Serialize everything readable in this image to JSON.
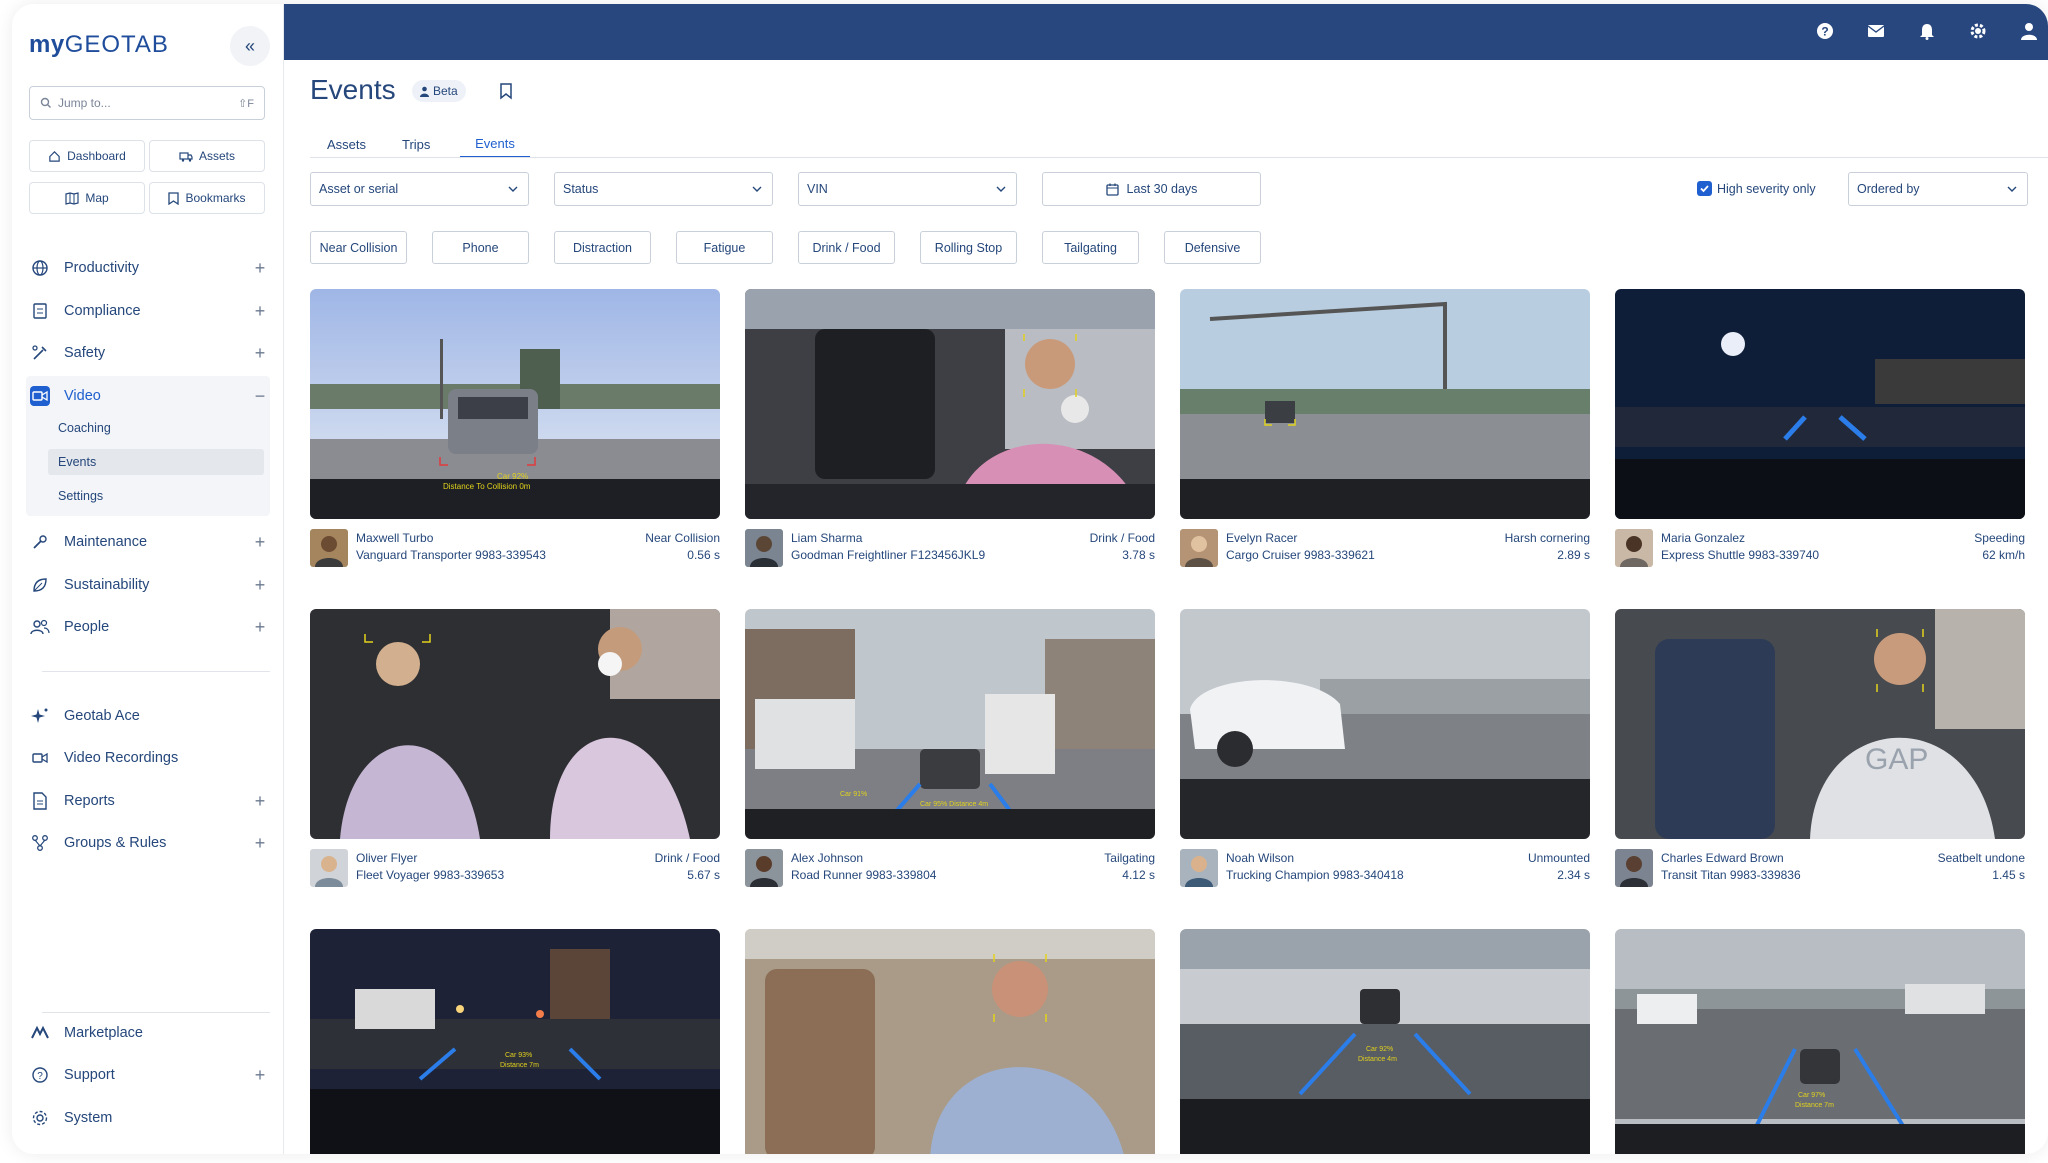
{
  "brand": {
    "logo_bold": "my",
    "logo_rest": "GEOTAB"
  },
  "search": {
    "placeholder": "Jump to...",
    "shortcut": "⇧F"
  },
  "quick_links": [
    {
      "label": "Dashboard",
      "icon": "home-icon"
    },
    {
      "label": "Assets",
      "icon": "truck-icon"
    },
    {
      "label": "Map",
      "icon": "map-icon"
    },
    {
      "label": "Bookmarks",
      "icon": "bookmark-icon"
    }
  ],
  "sidebar": {
    "items": [
      {
        "label": "Productivity",
        "icon": "globe-icon",
        "expandable": true
      },
      {
        "label": "Compliance",
        "icon": "clipboard-icon",
        "expandable": true
      },
      {
        "label": "Safety",
        "icon": "wrench-pen-icon",
        "expandable": true
      },
      {
        "label": "Video",
        "icon": "video-camera-icon",
        "expanded": true
      },
      {
        "label": "Maintenance",
        "icon": "wrench-icon",
        "expandable": true
      },
      {
        "label": "Sustainability",
        "icon": "leaf-icon",
        "expandable": true
      },
      {
        "label": "People",
        "icon": "people-icon",
        "expandable": true
      },
      {
        "label": "Geotab Ace",
        "icon": "sparkle-icon"
      },
      {
        "label": "Video Recordings",
        "icon": "video-camera-icon"
      },
      {
        "label": "Reports",
        "icon": "report-icon",
        "expandable": true
      },
      {
        "label": "Groups & Rules",
        "icon": "groups-icon",
        "expandable": true
      },
      {
        "label": "Marketplace",
        "icon": "marketplace-icon"
      },
      {
        "label": "Support",
        "icon": "help-icon",
        "expandable": true
      },
      {
        "label": "System",
        "icon": "gear-icon"
      }
    ],
    "video_sub": [
      "Coaching",
      "Events",
      "Settings"
    ],
    "selected_sub": "Events"
  },
  "topbar_icons": [
    "help-icon",
    "mail-icon",
    "bell-icon",
    "gear-icon",
    "user-icon"
  ],
  "page": {
    "title": "Events",
    "badge": "Beta"
  },
  "tabs": [
    "Assets",
    "Trips",
    "Events"
  ],
  "active_tab": "Events",
  "filters": {
    "asset": "Asset or serial",
    "status": "Status",
    "vin": "VIN",
    "date_range": "Last 30 days",
    "high_severity_label": "High severity only",
    "high_severity_checked": true,
    "ordered_by": "Ordered by"
  },
  "chips": [
    "Near Collision",
    "Phone",
    "Distraction",
    "Fatigue",
    "Drink / Food",
    "Rolling Stop",
    "Tailgating",
    "Defensive"
  ],
  "colors": {
    "topbar": "#27477e",
    "accent": "#1f5fcf",
    "text": "#25477b"
  },
  "events": [
    {
      "driver": "Maxwell Turbo",
      "vehicle": "Vanguard Transporter 9983-339543",
      "type": "Near Collision",
      "duration": "0.56 s",
      "scene": "day-road",
      "overlay1": "Car 92%",
      "overlay2": "Distance To Collision 0m"
    },
    {
      "driver": "Liam Sharma",
      "vehicle": "Goodman Freightliner F123456JKL9",
      "type": "Drink / Food",
      "duration": "3.78 s",
      "scene": "cabin-pink"
    },
    {
      "driver": "Evelyn Racer",
      "vehicle": "Cargo Cruiser 9983-339621",
      "type": "Harsh cornering",
      "duration": "2.89 s",
      "scene": "intersection"
    },
    {
      "driver": "Maria Gonzalez",
      "vehicle": "Express Shuttle 9983-339740",
      "type": "Speeding",
      "duration": "62 km/h",
      "scene": "night-road"
    },
    {
      "driver": "Oliver Flyer",
      "vehicle": "Fleet Voyager 9983-339653",
      "type": "Drink / Food",
      "duration": "5.67 s",
      "scene": "cabin-two"
    },
    {
      "driver": "Alex Johnson",
      "vehicle": "Road Runner 9983-339804",
      "type": "Tailgating",
      "duration": "4.12 s",
      "scene": "city-traffic",
      "overlay1": "Car 91%",
      "overlay2": "Car 95% Distance 4m"
    },
    {
      "driver": "Noah Wilson",
      "vehicle": "Trucking Champion 9983-340418",
      "type": "Unmounted",
      "duration": "2.34 s",
      "scene": "overcast-road"
    },
    {
      "driver": "Charles Edward Brown",
      "vehicle": "Transit Titan 9983-339836",
      "type": "Seatbelt undone",
      "duration": "1.45 s",
      "scene": "cabin-grey"
    },
    {
      "scene": "dusk-road",
      "overlay1": "Car 93%",
      "overlay2": "Distance 7m"
    },
    {
      "scene": "cabin-beige"
    },
    {
      "scene": "highway-rain",
      "overlay1": "Car 92%",
      "overlay2": "Distance 4m"
    },
    {
      "scene": "freeway-haze",
      "overlay1": "Car 97%",
      "overlay2": "Distance 7m"
    }
  ]
}
